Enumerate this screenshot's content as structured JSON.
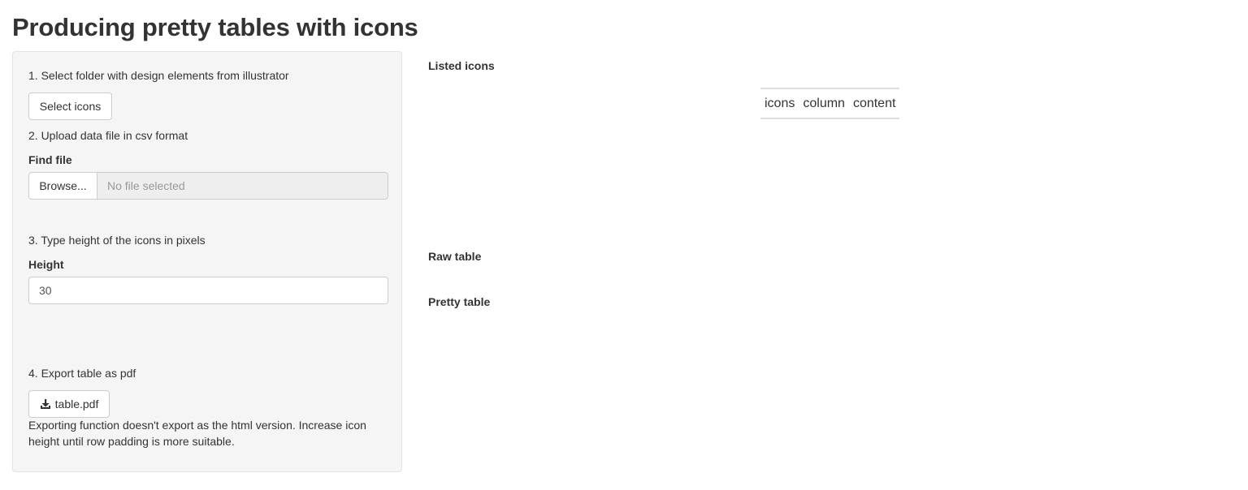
{
  "page": {
    "title": "Producing pretty tables with icons"
  },
  "sidebar": {
    "step1": {
      "text": "1. Select folder with design elements from illustrator",
      "button": "Select icons"
    },
    "step2": {
      "text": "2. Upload data file in csv format",
      "label": "Find file",
      "browse": "Browse...",
      "placeholder": "No file selected"
    },
    "step3": {
      "text": "3. Type height of the icons in pixels",
      "label": "Height",
      "value": "30"
    },
    "step4": {
      "text": "4. Export table as pdf",
      "button": "table.pdf",
      "button_icon": "download-icon",
      "help": "Exporting function doesn't export as the html version. Increase icon height until row padding is more suitable."
    }
  },
  "main": {
    "listed_icons_label": "Listed icons",
    "icons_table": {
      "columns": [
        "icons",
        "column",
        "content"
      ]
    },
    "raw_table_label": "Raw table",
    "pretty_table_label": "Pretty table"
  }
}
